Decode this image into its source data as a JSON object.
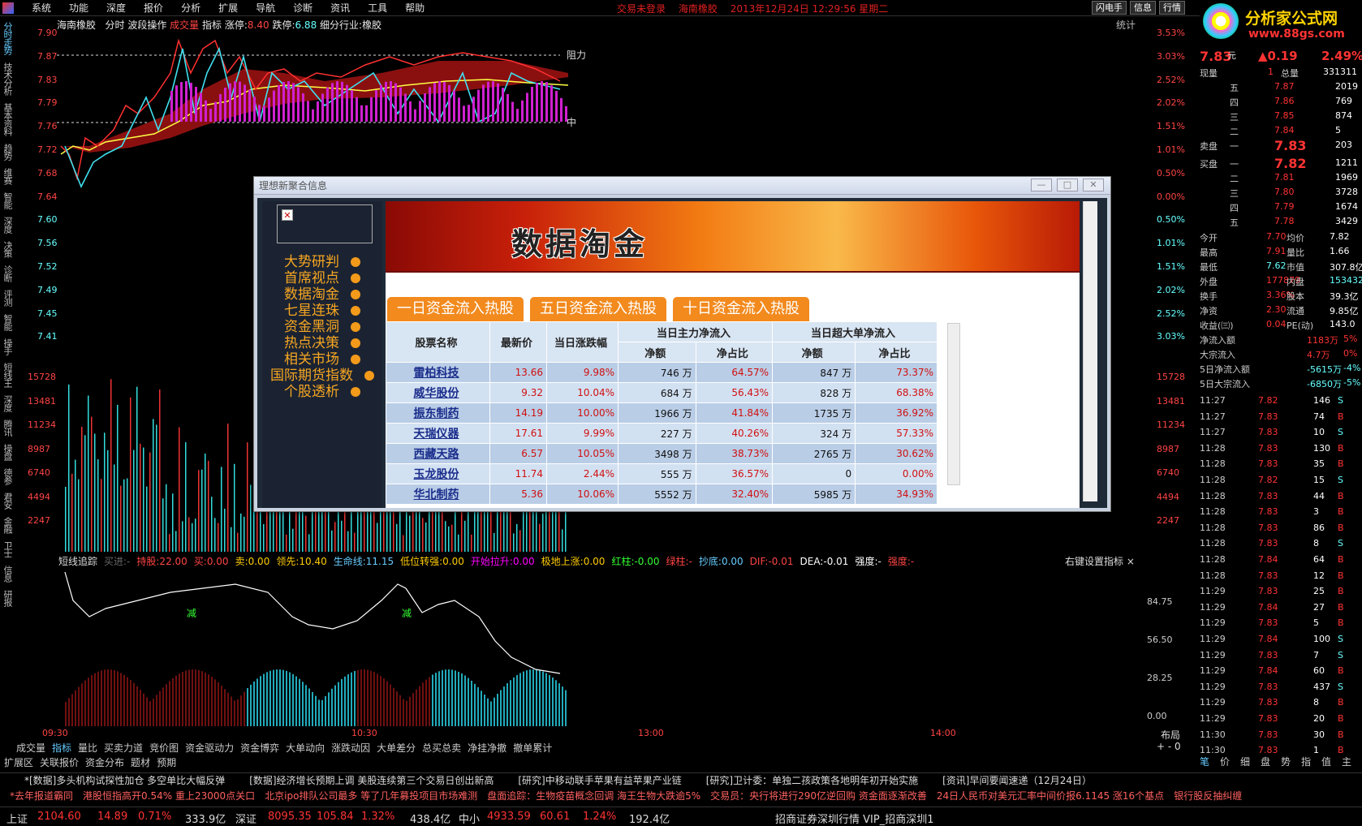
{
  "menu": [
    "系统",
    "功能",
    "深度",
    "报价",
    "分析",
    "扩展",
    "导航",
    "诊断",
    "资讯",
    "工具",
    "帮助"
  ],
  "title_status": {
    "login": "交易未登录",
    "stock": "海南橡胶",
    "datetime": "2013年12月24日  12:29:56  星期二"
  },
  "top_buttons": [
    "闪电手",
    "信息",
    "行情"
  ],
  "brand": {
    "name": "分析家公式网",
    "url": "www.88gs.com"
  },
  "left_tabs": [
    "分时走势",
    "技术分析",
    "基本资料",
    "趋势",
    "维赛",
    "智能",
    "深度",
    "决策",
    "诊断",
    "评测",
    "智能",
    "操手",
    "短线王",
    "深度",
    "腾讯",
    "操盘",
    "德参",
    "君安",
    "金融",
    "卫士",
    "信息",
    "研报"
  ],
  "chart_header": {
    "name": "海南橡胶",
    "items": [
      "分时",
      "波段操作"
    ],
    "vol": "成交量",
    "ind": "指标",
    "up_label": "涨停:",
    "up": "8.40",
    "down_label": "跌停:",
    "down": "6.88",
    "industry": "细分行业:橡胶"
  },
  "stat_label": "统计",
  "price_axis_left": [
    "7.90",
    "7.87",
    "7.83",
    "7.79",
    "7.76",
    "7.72",
    "7.68",
    "7.64",
    "7.60",
    "7.56",
    "7.52",
    "7.49",
    "7.45",
    "7.41"
  ],
  "pct_axis_right": [
    "3.53%",
    "3.03%",
    "2.52%",
    "2.02%",
    "1.51%",
    "1.01%",
    "0.50%",
    "0.00%",
    "0.50%",
    "1.01%",
    "1.51%",
    "2.02%",
    "2.52%",
    "3.03%"
  ],
  "vol_axis": [
    "15728",
    "13481",
    "11234",
    "8987",
    "6740",
    "4494",
    "2247"
  ],
  "chart_labels": {
    "resist": "阻力",
    "mid": "中"
  },
  "ind_header": [
    "短线追踪",
    "买进:-",
    "持股:22.00",
    "买:0.00",
    "卖:0.00",
    "领先:10.40",
    "生命线:11.15",
    "低位转强:0.00",
    "开始拉升:0.00",
    "极地上涨:0.00",
    "红柱:-0.00",
    "绿柱:-",
    "抄底:0.00",
    "DIF:-0.01",
    "DEA:-0.01",
    "强度:-",
    "强度:-"
  ],
  "ind_right": "右键设置指标 ×",
  "ind_axis": [
    "84.75",
    "56.50",
    "28.25",
    "0.00"
  ],
  "ind_marks": [
    "减",
    "减"
  ],
  "time_axis": [
    "09:30",
    "10:30",
    "13:00",
    "14:00"
  ],
  "bottom_tabs": [
    "成交量",
    "指标",
    "量比",
    "买卖力道",
    "竞价图",
    "资金驱动力",
    "资金博弈",
    "大单动向",
    "涨跌动因",
    "大单差分",
    "总买总卖",
    "净挂净撤",
    "撤单累计"
  ],
  "sub_tabs": [
    "扩展区",
    "关联报价",
    "资金分布",
    "题材",
    "预期"
  ],
  "layout_labels": [
    "布局",
    "+ - 0"
  ],
  "right": {
    "price": "7.83",
    "unit": "元",
    "change": "▲0.19",
    "pct": "2.49%",
    "now_label": "现量",
    "now": "1",
    "total_label": "总量",
    "total": "331311",
    "sells": [
      [
        "五",
        "7.87",
        "2019"
      ],
      [
        "四",
        "7.86",
        "769"
      ],
      [
        "三",
        "7.85",
        "874"
      ],
      [
        "二",
        "7.84",
        "5"
      ],
      [
        "一",
        "7.83",
        "203"
      ]
    ],
    "buys": [
      [
        "一",
        "7.82",
        "1211"
      ],
      [
        "二",
        "7.81",
        "1969"
      ],
      [
        "三",
        "7.80",
        "3728"
      ],
      [
        "四",
        "7.79",
        "1674"
      ],
      [
        "五",
        "7.78",
        "3429"
      ]
    ],
    "sell_label": "卖盘",
    "buy_label": "买盘",
    "stats": [
      [
        "今开",
        "7.70",
        "均价",
        "7.82"
      ],
      [
        "最高",
        "7.91",
        "量比",
        "1.66"
      ],
      [
        "最低",
        "7.62",
        "市值",
        "307.8亿"
      ],
      [
        "外盘",
        "177879",
        "内盘",
        "153432"
      ],
      [
        "换手",
        "3.36%",
        "股本",
        "39.3亿"
      ],
      [
        "净资",
        "2.30",
        "流通",
        "9.85亿"
      ],
      [
        "收益(㈢)",
        "0.04",
        "PE(动)",
        "143.0"
      ]
    ],
    "flows": [
      [
        "净流入额",
        "1183万",
        "5%"
      ],
      [
        "大宗流入",
        "4.7万",
        "0%"
      ],
      [
        "5日净流入额",
        "-5615万",
        "-4%"
      ],
      [
        "5日大宗流入",
        "-6850万",
        "-5%"
      ]
    ],
    "ticks": [
      [
        "11:27",
        "7.82",
        "146",
        "S"
      ],
      [
        "11:27",
        "7.83",
        "74",
        "B"
      ],
      [
        "11:27",
        "7.83",
        "10",
        "S"
      ],
      [
        "11:28",
        "7.83",
        "130",
        "B"
      ],
      [
        "11:28",
        "7.83",
        "35",
        "B"
      ],
      [
        "11:28",
        "7.82",
        "15",
        "S"
      ],
      [
        "11:28",
        "7.83",
        "44",
        "B"
      ],
      [
        "11:28",
        "7.83",
        "3",
        "B"
      ],
      [
        "11:28",
        "7.83",
        "86",
        "B"
      ],
      [
        "11:28",
        "7.83",
        "8",
        "S"
      ],
      [
        "11:28",
        "7.84",
        "64",
        "B"
      ],
      [
        "11:28",
        "7.83",
        "12",
        "B"
      ],
      [
        "11:29",
        "7.83",
        "25",
        "B"
      ],
      [
        "11:29",
        "7.84",
        "27",
        "B"
      ],
      [
        "11:29",
        "7.83",
        "5",
        "B"
      ],
      [
        "11:29",
        "7.84",
        "100",
        "S"
      ],
      [
        "11:29",
        "7.83",
        "7",
        "S"
      ],
      [
        "11:29",
        "7.84",
        "60",
        "B"
      ],
      [
        "11:29",
        "7.83",
        "437",
        "S"
      ],
      [
        "11:29",
        "7.83",
        "8",
        "B"
      ],
      [
        "11:29",
        "7.83",
        "20",
        "B"
      ],
      [
        "11:30",
        "7.83",
        "30",
        "B"
      ],
      [
        "11:30",
        "7.83",
        "1",
        "B"
      ]
    ],
    "bottom_tabs": [
      "笔",
      "价",
      "细",
      "盘",
      "势",
      "指",
      "值",
      "主"
    ]
  },
  "popup": {
    "title": "理想新聚合信息",
    "side_items": [
      "大势研判",
      "首席视点",
      "数据淘金",
      "七星连珠",
      "资金黑洞",
      "热点决策",
      "相关市场",
      "国际期货指数",
      "个股透析"
    ],
    "banner": "数据淘金",
    "tabs": [
      "一日资金流入热股",
      "五日资金流入热股",
      "十日资金流入热股"
    ],
    "headers": {
      "name": "股票名称",
      "price": "最新价",
      "chg": "当日涨跌幅",
      "main": "当日主力净流入",
      "big": "当日超大单净流入",
      "amt": "净额",
      "ratio": "净占比"
    },
    "rows": [
      [
        "雷柏科技",
        "13.66",
        "9.98%",
        "746 万",
        "64.57%",
        "847 万",
        "73.37%"
      ],
      [
        "威华股份",
        "9.32",
        "10.04%",
        "684 万",
        "56.43%",
        "828 万",
        "68.38%"
      ],
      [
        "振东制药",
        "14.19",
        "10.00%",
        "1966 万",
        "41.84%",
        "1735 万",
        "36.92%"
      ],
      [
        "天瑞仪器",
        "17.61",
        "9.99%",
        "227 万",
        "40.26%",
        "324 万",
        "57.33%"
      ],
      [
        "西藏天路",
        "6.57",
        "10.05%",
        "3498 万",
        "38.73%",
        "2765 万",
        "30.62%"
      ],
      [
        "玉龙股份",
        "11.74",
        "2.44%",
        "555 万",
        "36.57%",
        "0",
        "0.00%"
      ],
      [
        "华北制药",
        "5.36",
        "10.06%",
        "5552 万",
        "32.40%",
        "5985 万",
        "34.93%"
      ]
    ]
  },
  "news1": [
    "*[数据]多头机构试探性加仓 多空单比大幅反弹",
    "[数据]经济增长预期上调 美股连续第三个交易日创出新高",
    "[研究]中移动联手苹果有益苹果产业链",
    "[研究]卫计委：单独二孩政策各地明年初开始实施",
    "[资讯]早间要闻速递（12月24日）"
  ],
  "news2": [
    "*去年报道霸同",
    "港股恒指高开0.54% 重上23000点关口",
    "北京ipo排队公司最多 等了几年募投项目市场难测",
    "盘面追踪：生物疫苗概念回调 海王生物大跌逾5%",
    "交易员：央行将进行290亿逆回购 资金面逐渐改善",
    "24日人民币对美元汇率中间价报6.1145 涨16个基点",
    "银行股反抽纠缠"
  ],
  "status": {
    "sh": "上证",
    "sh_v": "2104.60",
    "sh_c": "14.89",
    "sh_p": "0.71%",
    "sh_a": "333.9亿",
    "sz": "深证",
    "sz_v": "8095.35",
    "sz_c": "105.84",
    "sz_p": "1.32%",
    "sz_a": "438.4亿",
    "zx": "中小",
    "zx_v": "4933.59",
    "zx_c": "60.61",
    "zx_p": "1.24%",
    "zx_a": "192.4亿",
    "broker": "招商证券深圳行情 VIP_招商深圳1"
  },
  "colors": {
    "up": "#ff3333",
    "down": "#00e0e0",
    "accent": "#f28a1e"
  }
}
